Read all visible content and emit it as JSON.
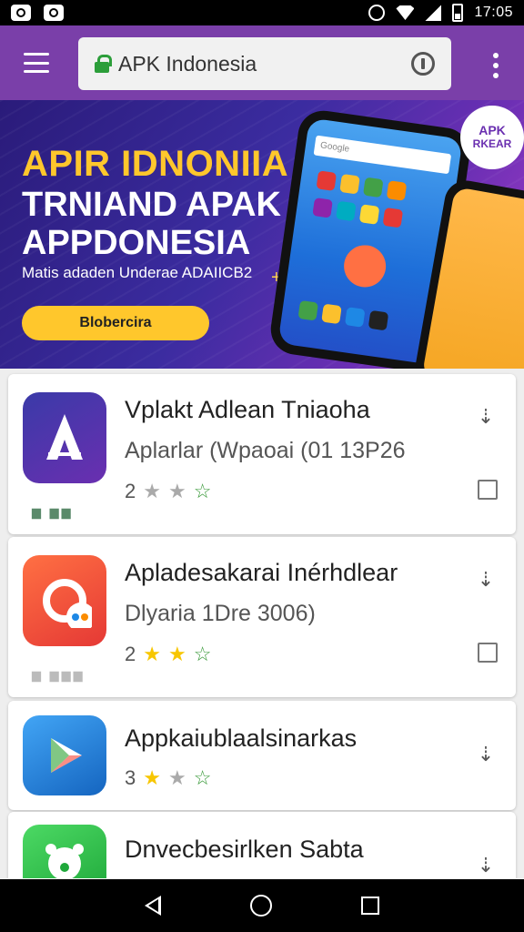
{
  "status_bar": {
    "time": "17:05"
  },
  "browser": {
    "url_text": "APK Indonesia"
  },
  "banner": {
    "headline1": "APIR IDNONIIA",
    "headline2": "TRNIAND APAK",
    "headline3": "APPDONESIA",
    "subtitle": "Matis adaden Underae ADAIICB2",
    "button_label": "Blobercira",
    "badge_line1": "APK",
    "badge_line2": "RKEAR",
    "phone_search": "Google"
  },
  "apps": [
    {
      "title": "Vplakt Adlean Tniaoha",
      "subtitle": "Aplarlar (Wpaoai (01 13P26",
      "rating_value": "2",
      "stars": [
        "gray",
        "gray",
        "outline"
      ],
      "has_checkbox": true,
      "tiny_label": "▆ ▆▆",
      "icon_color": "#4b2aa0"
    },
    {
      "title": "Apladesakarai Inérhdlear",
      "subtitle": "Dlyaria 1Dre 3006)",
      "rating_value": "2",
      "stars": [
        "yellow",
        "yellow",
        "outline"
      ],
      "has_checkbox": true,
      "tiny_label": "▆ ▆▆▆",
      "icon_color": "#e53935"
    },
    {
      "title": "Appkaiublaalsinarkas",
      "subtitle": "",
      "rating_value": "3",
      "stars": [
        "yellow",
        "gray",
        "outline"
      ],
      "has_checkbox": false,
      "icon_color": "#1e88e5"
    },
    {
      "title": "Dnvecbesirlken Sabta",
      "subtitle": "",
      "rating_value": "",
      "stars": [],
      "has_checkbox": false,
      "icon_color": "#2fbf4a"
    }
  ],
  "icons": {
    "menu": "hamburger-icon",
    "lock": "lock-icon",
    "info": "info-icon",
    "more": "more-vert-icon",
    "download": "download-icon",
    "back": "back-icon",
    "home": "home-icon",
    "recents": "recents-icon"
  },
  "colors": {
    "appbar": "#7a3fa9",
    "accent": "#ffc72c",
    "star": "#f7c600"
  }
}
